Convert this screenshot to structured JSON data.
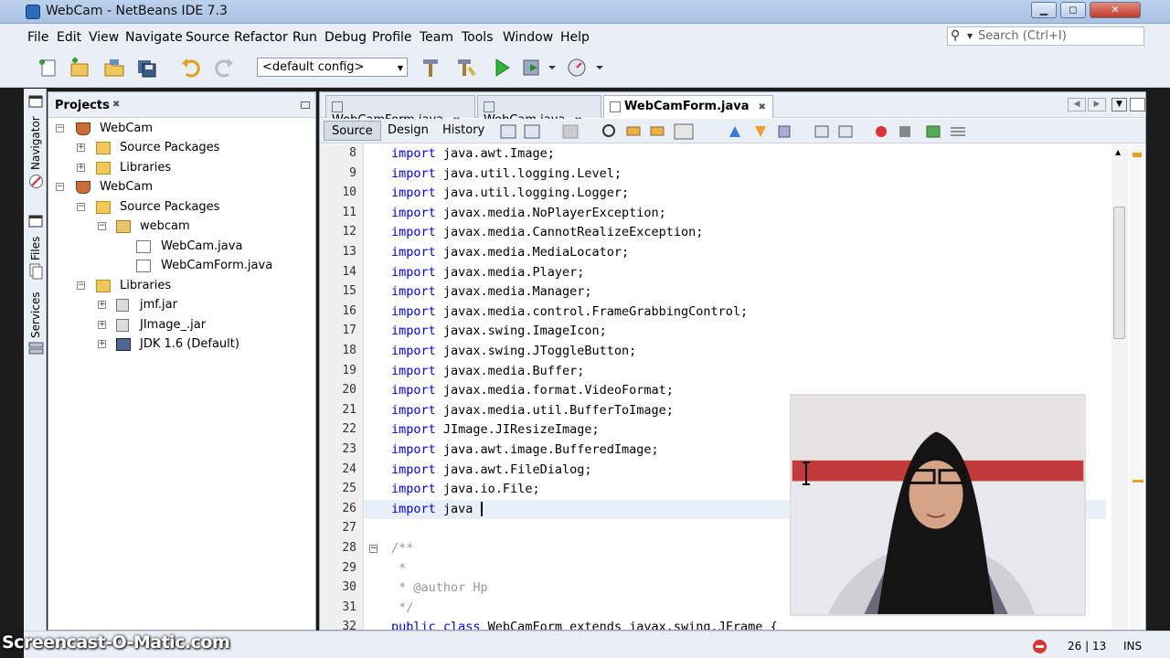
{
  "window": {
    "title": "WebCam - NetBeans IDE 7.3",
    "min": "▁",
    "max": "◻",
    "close": "✕"
  },
  "menu": [
    "File",
    "Edit",
    "View",
    "Navigate",
    "Source",
    "Refactor",
    "Run",
    "Debug",
    "Profile",
    "Team",
    "Tools",
    "Window",
    "Help"
  ],
  "search": {
    "placeholder": "Search (Ctrl+I)"
  },
  "toolbar": {
    "config_value": "<default config>"
  },
  "side_strip": {
    "navigator": "Navigator",
    "files": "Files",
    "services": "Services"
  },
  "projects": {
    "title": "Projects",
    "tree": [
      {
        "label": "WebCam",
        "icon": "project-icon"
      },
      {
        "label": "Source Packages",
        "icon": "source-packages-icon"
      },
      {
        "label": "Libraries",
        "icon": "libraries-icon"
      },
      {
        "label": "WebCam",
        "icon": "project-icon"
      },
      {
        "label": "Source Packages",
        "icon": "source-packages-icon"
      },
      {
        "label": "webcam",
        "icon": "package-icon"
      },
      {
        "label": "WebCam.java",
        "icon": "java-file-icon"
      },
      {
        "label": "WebCamForm.java",
        "icon": "java-form-icon"
      },
      {
        "label": "Libraries",
        "icon": "libraries-icon"
      },
      {
        "label": "jmf.jar",
        "icon": "jar-icon"
      },
      {
        "label": "JImage_.jar",
        "icon": "jar-icon"
      },
      {
        "label": "JDK 1.6 (Default)",
        "icon": "jdk-icon"
      }
    ]
  },
  "editor": {
    "tabs": [
      "WebCamForm.java",
      "WebCam.java",
      "WebCamForm.java"
    ],
    "views": [
      "Source",
      "Design",
      "History"
    ],
    "lines": [
      {
        "n": "8",
        "kw": "import",
        "text": " java.awt.Image;"
      },
      {
        "n": "9",
        "kw": "import",
        "text": " java.util.logging.Level;"
      },
      {
        "n": "10",
        "kw": "import",
        "text": " java.util.logging.Logger;"
      },
      {
        "n": "11",
        "kw": "import",
        "text": " javax.media.NoPlayerException;"
      },
      {
        "n": "12",
        "kw": "import",
        "text": " javax.media.CannotRealizeException;"
      },
      {
        "n": "13",
        "kw": "import",
        "text": " javax.media.MediaLocator;"
      },
      {
        "n": "14",
        "kw": "import",
        "text": " javax.media.Player;"
      },
      {
        "n": "15",
        "kw": "import",
        "text": " javax.media.Manager;"
      },
      {
        "n": "16",
        "kw": "import",
        "text": " javax.media.control.FrameGrabbingControl;"
      },
      {
        "n": "17",
        "kw": "import",
        "text": " javax.swing.ImageIcon;"
      },
      {
        "n": "18",
        "kw": "import",
        "text": " javax.swing.JToggleButton;"
      },
      {
        "n": "19",
        "kw": "import",
        "text": " javax.media.Buffer;"
      },
      {
        "n": "20",
        "kw": "import",
        "text": " javax.media.format.VideoFormat;"
      },
      {
        "n": "21",
        "kw": "import",
        "text": " javax.media.util.BufferToImage;"
      },
      {
        "n": "22",
        "kw": "import",
        "text": " JImage.JIResizeImage;"
      },
      {
        "n": "23",
        "kw": "import",
        "text": " java.awt.image.BufferedImage;"
      },
      {
        "n": "24",
        "kw": "import",
        "text": " java.awt.FileDialog;"
      },
      {
        "n": "25",
        "kw": "import",
        "text": " java.io.File;"
      },
      {
        "n": "26",
        "kw": "import",
        "text": " java "
      },
      {
        "n": "27",
        "kw": "",
        "text": ""
      },
      {
        "n": "28",
        "kw": "",
        "text": "/**"
      },
      {
        "n": "29",
        "kw": "",
        "text": " *"
      },
      {
        "n": "30",
        "kw": "",
        "text": " * @author Hp"
      },
      {
        "n": "31",
        "kw": "",
        "text": " */"
      },
      {
        "n": "32",
        "kw": "public class",
        "text": " WebCamForm extends javax.swing.JFrame {"
      }
    ]
  },
  "status": {
    "position": "26 | 13",
    "mode": "INS"
  },
  "watermark": "Screencast-O-Matic.com",
  "colors": {
    "keyword": "#0000e6",
    "comment": "#969696",
    "titlebar": "#bcd3ee"
  }
}
